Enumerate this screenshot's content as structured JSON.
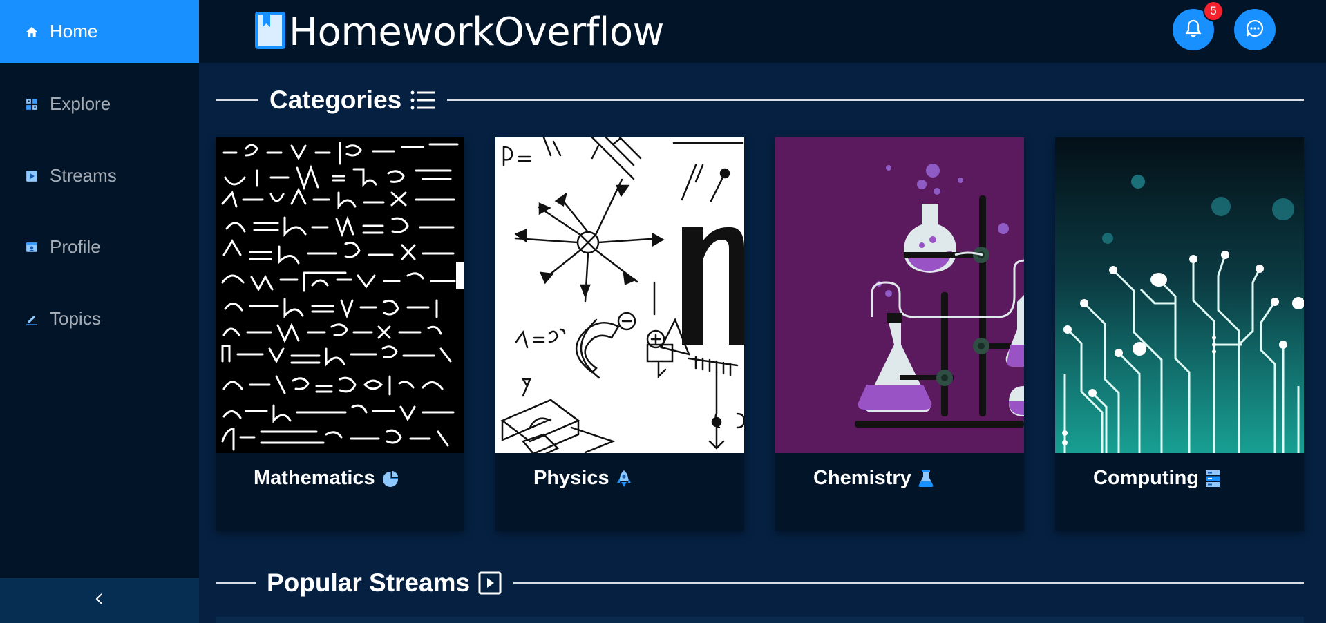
{
  "app": {
    "name": "HomeworkOverflow"
  },
  "sidebar": {
    "items": [
      {
        "label": "Home",
        "icon": "home-icon",
        "active": true
      },
      {
        "label": "Explore",
        "icon": "grid-icon",
        "active": false
      },
      {
        "label": "Streams",
        "icon": "play-square-icon",
        "active": false
      },
      {
        "label": "Profile",
        "icon": "id-card-icon",
        "active": false
      },
      {
        "label": "Topics",
        "icon": "edit-icon",
        "active": false
      }
    ],
    "collapse_icon": "chevron-left-icon"
  },
  "header": {
    "logo_icon": "book-icon",
    "notifications": {
      "icon": "bell-icon",
      "count": "5"
    },
    "messages": {
      "icon": "message-icon"
    }
  },
  "sections": {
    "categories": {
      "title": "Categories",
      "icon": "list-icon"
    },
    "popular_streams": {
      "title": "Popular Streams",
      "icon": "play-square-icon"
    }
  },
  "categories": [
    {
      "label": "Mathematics",
      "icon": "pie-chart-icon"
    },
    {
      "label": "Physics",
      "icon": "rocket-icon"
    },
    {
      "label": "Chemistry",
      "icon": "experiment-icon"
    },
    {
      "label": "Computing",
      "icon": "database-icon"
    }
  ],
  "colors": {
    "accent": "#1890ff",
    "sidebar_bg": "#021528",
    "content_bg": "#052041",
    "badge": "#f5222d",
    "chemistry_bg": "#5b1a5e"
  }
}
